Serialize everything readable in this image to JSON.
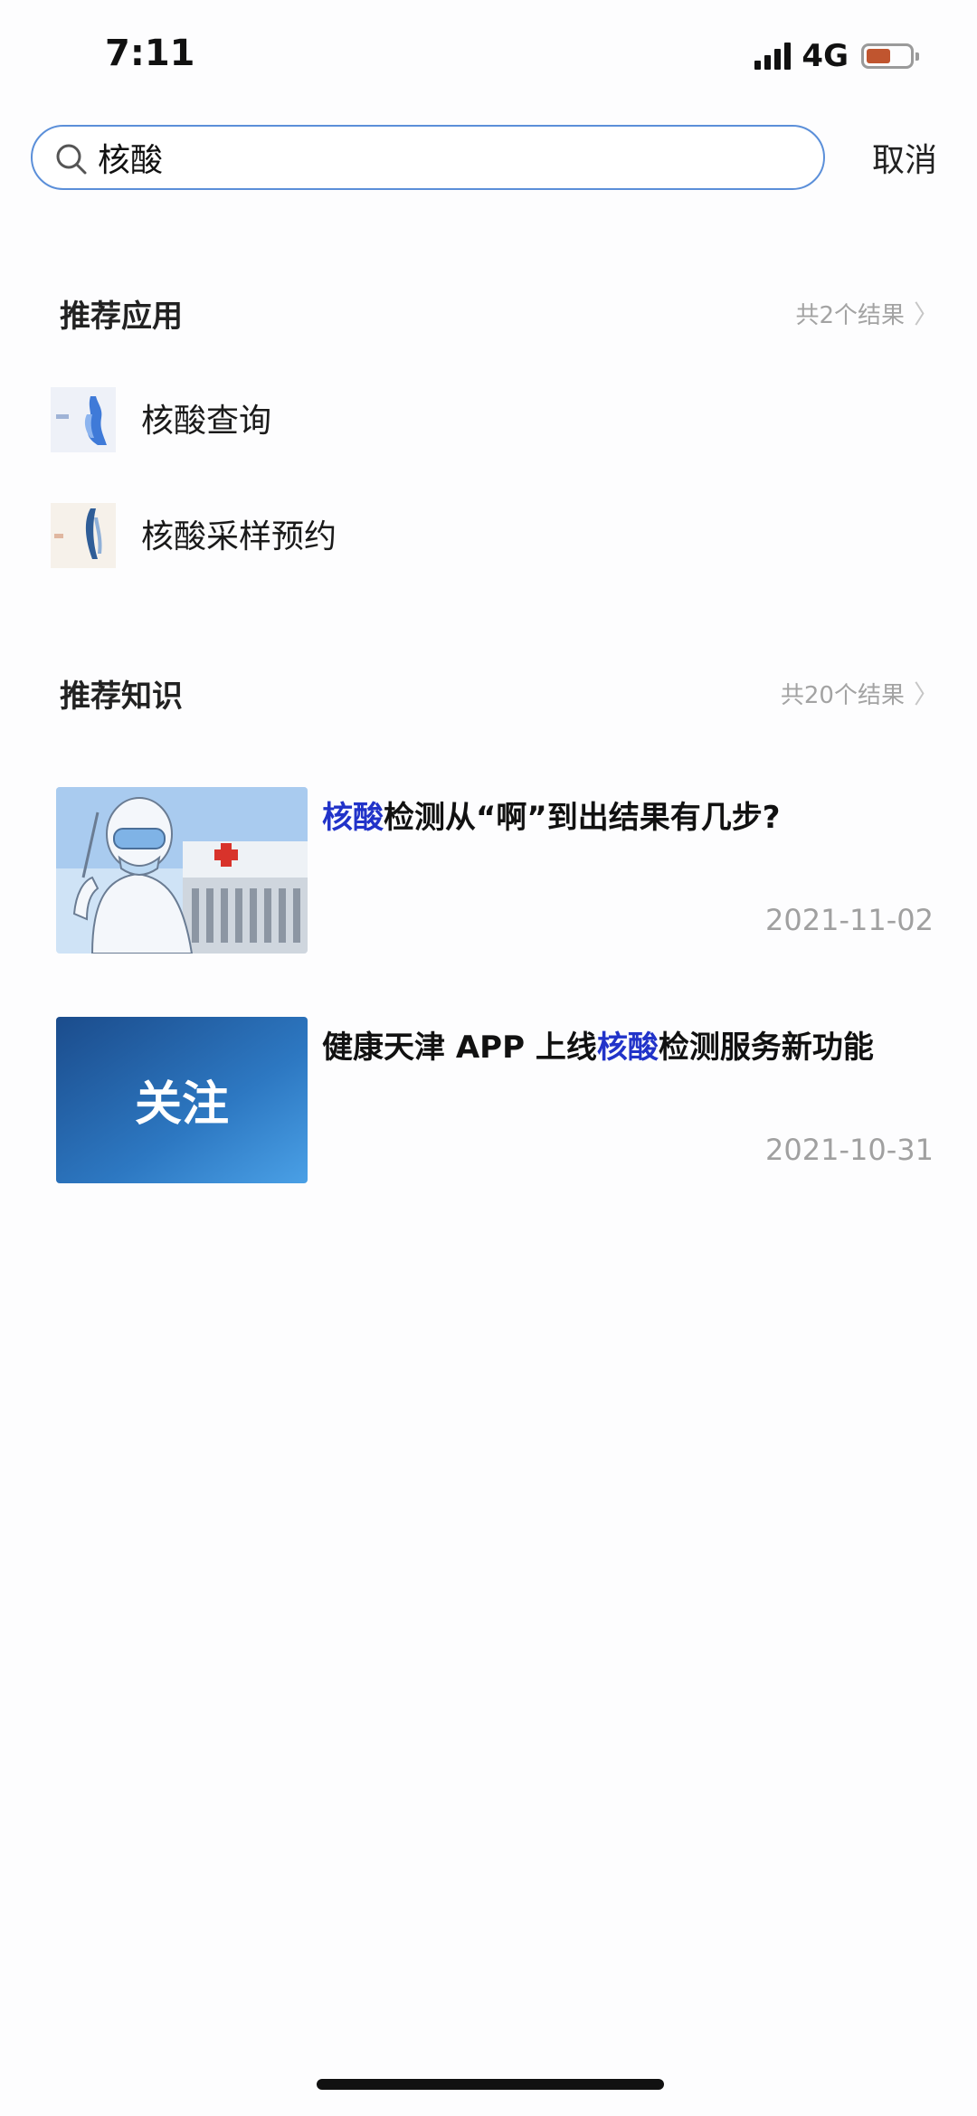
{
  "status_bar": {
    "time": "7:11",
    "network": "4G",
    "battery_color": "#c0552f"
  },
  "search": {
    "query": "核酸",
    "placeholder": "",
    "cancel_label": "取消"
  },
  "apps_section": {
    "title": "推荐应用",
    "count_label": "共2个结果",
    "items": [
      {
        "label": "核酸查询",
        "icon": "nucleic-query-app-icon"
      },
      {
        "label": "核酸采样预约",
        "icon": "nucleic-sampling-app-icon"
      }
    ]
  },
  "knowledge_section": {
    "title": "推荐知识",
    "count_label": "共20个结果",
    "articles": [
      {
        "title_highlight": "核酸",
        "title_rest": "检测从“啊”到出结果有几步?",
        "date": "2021-11-02",
        "thumbnail": "health-worker-swab-illustration"
      },
      {
        "title_before": "健康天津 APP 上线",
        "title_highlight": "核酸",
        "title_after": "检测服务新功能",
        "date": "2021-10-31",
        "thumbnail": "guanzhu-banner",
        "thumbnail_text": "关注"
      }
    ]
  },
  "colors": {
    "highlight": "#2133c9",
    "search_border": "#5b8fd9"
  }
}
